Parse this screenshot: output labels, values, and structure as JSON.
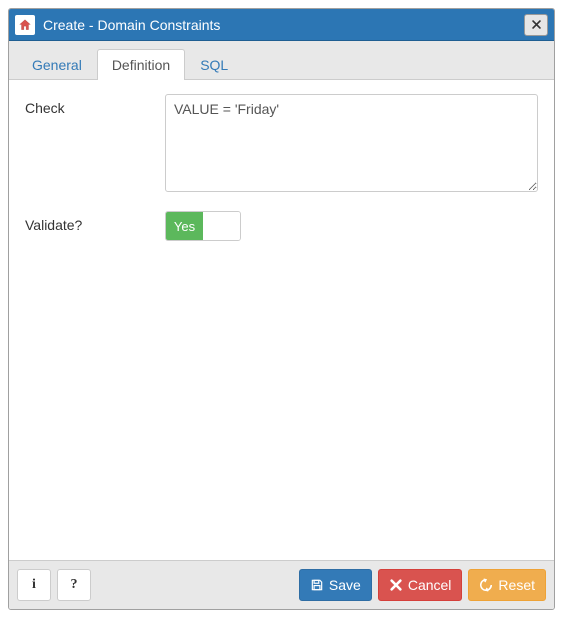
{
  "titlebar": {
    "title": "Create - Domain Constraints"
  },
  "tabs": {
    "general": "General",
    "definition": "Definition",
    "sql": "SQL",
    "active": "definition"
  },
  "form": {
    "check_label": "Check",
    "check_value": "VALUE = 'Friday'",
    "validate_label": "Validate?",
    "validate_on_text": "Yes",
    "validate_value": true
  },
  "footer": {
    "info_label": "i",
    "help_label": "?",
    "save_label": "Save",
    "cancel_label": "Cancel",
    "reset_label": "Reset"
  }
}
